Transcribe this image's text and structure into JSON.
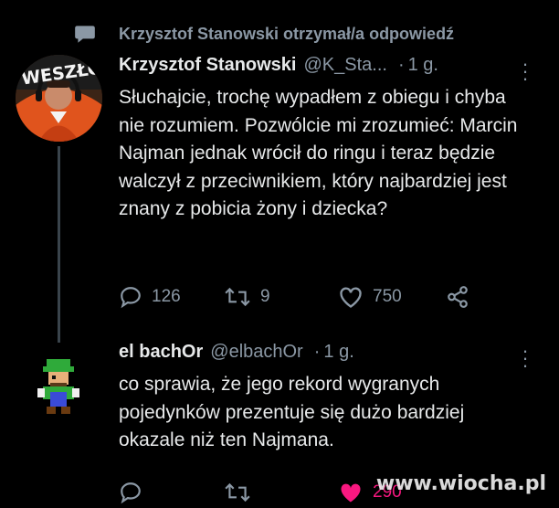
{
  "context": {
    "icon": "speech-bubble-icon",
    "text": "Krzysztof Stanowski otrzymał/a odpowiedź"
  },
  "tweet1": {
    "avatar_text": "WESZŁO",
    "name": "Krzysztof Stanowski",
    "handle": "@K_Sta...",
    "time": "1 g.",
    "text": "Słuchajcie, trochę wypadłem z obiegu i chyba nie rozumiem. Pozwólcie mi zrozumieć: Marcin Najman jednak wrócił do ringu i teraz będzie walczył z przeciwnikiem, który najbardziej jest znany z pobicia żony i dziecka?",
    "replies": "126",
    "retweets": "9",
    "likes": "750"
  },
  "tweet2": {
    "name": "el bachOr",
    "handle": "@elbachOr",
    "time": "1 g.",
    "text": "co sprawia, że jego rekord wygranych pojedynków prezentuje się dużo bardziej okazale niż ten Najmana.",
    "likes": "290",
    "like_color": "#f91880"
  },
  "watermark": "www.wiocha.pl",
  "colors": {
    "background": "#000000",
    "text": "#e7e9ea",
    "muted": "#8b98a5"
  }
}
